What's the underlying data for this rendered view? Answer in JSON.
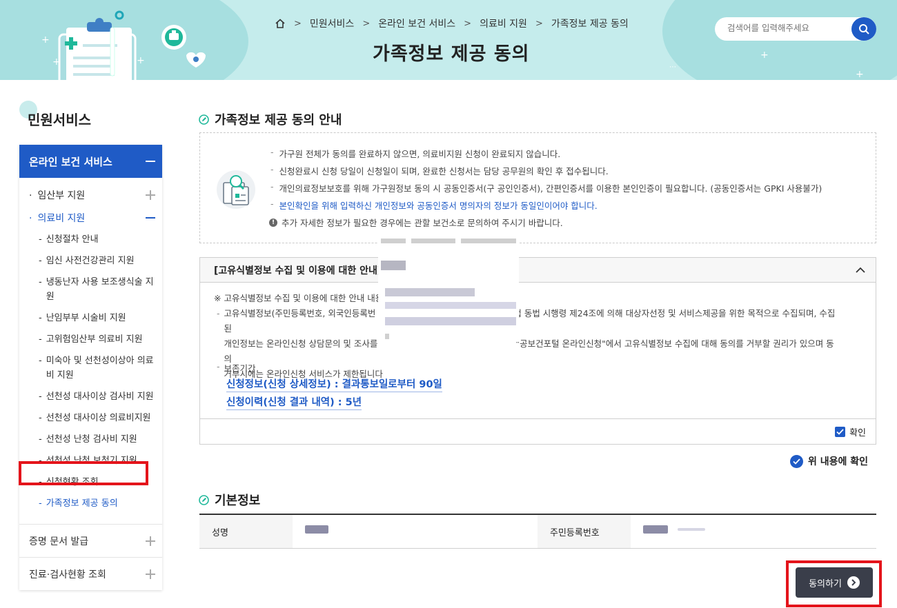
{
  "header": {
    "breadcrumb": [
      "민원서비스",
      "온라인 보건 서비스",
      "의료비 지원",
      "가족정보 제공 동의"
    ],
    "title": "가족정보 제공 동의",
    "search_placeholder": "검색어를 입력해주세요"
  },
  "sidebar": {
    "title": "민원서비스",
    "section": "온라인 보건 서비스",
    "level1": [
      {
        "label": "임산부 지원"
      },
      {
        "label": "의료비 지원"
      }
    ],
    "level2": [
      "신청절차 안내",
      "임신 사전건강관리 지원",
      "냉동난자 사용 보조생식술 지원",
      "난임부부 시술비 지원",
      "고위험임산부 의료비 지원",
      "미숙아 및 선천성이상아 의료비 지원",
      "선천성 대사이상 검사비 지원",
      "선천성 대사이상 의료비지원",
      "선천성 난청 검사비 지원",
      "선천성 난청 보청기 지원",
      "신청현황 조회",
      "가족정보 제공 동의"
    ],
    "groups": [
      "증명 문서 발급",
      "진료·검사현황 조회"
    ]
  },
  "notice": {
    "title": "가족정보 제공 동의 안내",
    "items": [
      "가구원 전체가 동의를 완료하지 않으면, 의료비지원 신청이 완료되지 않습니다.",
      "신청완료시 신청 당일이 신청일이 되며, 완료한 신청서는 담당 공무원의 확인 후 접수됩니다.",
      "개인의료정보보호를 위해 가구원정보 동의 시 공동인증서(구 공인인증서), 간편인증서를 이용한 본인인증이 필요합니다. (공동인증서는 GPKI 사용불가)",
      "본인확인을 위해 입력하신 개인정보와 공동인증서 명의자의 정보가 동일인이어야 합니다."
    ],
    "info": "추가 자세한 정보가 필요한 경우에는 관할 보건소로 문의하여 주시기 바랍니다."
  },
  "consent": {
    "head": "[고유식별정보 수집 및 이용에 대한 안내] (",
    "intro": "※ 고유식별정보 수집 및 이용에 대한 안내 내용",
    "body_line1": "고유식별정보(주민등록번호, 외국인등록번",
    "body_line1b": "법 동법 시행령 제24조에 의해 대상자선정 및 서비스제공을 위한 목적으로 수집되며, 수집된",
    "body_line2": "개인정보는 온라인신청 상담문의 및 조사를",
    "body_line2b": "\"공보건포털 온라인신청\"에서 고유식별정보 수집에 대해 동의를 거부할 권리가 있으며 동의",
    "body_line3": "거부시에는 온라인신청 서비스가 제한됩니다",
    "retention_label": "보존기간",
    "retention": [
      "신청정보(신청 상세정보) : 결과통보일로부터 90일",
      "신청이력(신청 결과 내역) : 5년"
    ],
    "check_label": "확인"
  },
  "confirm_all": "위 내용에 확인",
  "basic": {
    "title": "기본정보",
    "name_label": "성명",
    "rrn_label": "주민등록번호"
  },
  "agree_button": "동의하기",
  "colors": {
    "primary": "#1f5bc6",
    "hero_bg": "#c5ecec",
    "highlight": "#e4141b",
    "button_dark": "#3a3e4a"
  }
}
